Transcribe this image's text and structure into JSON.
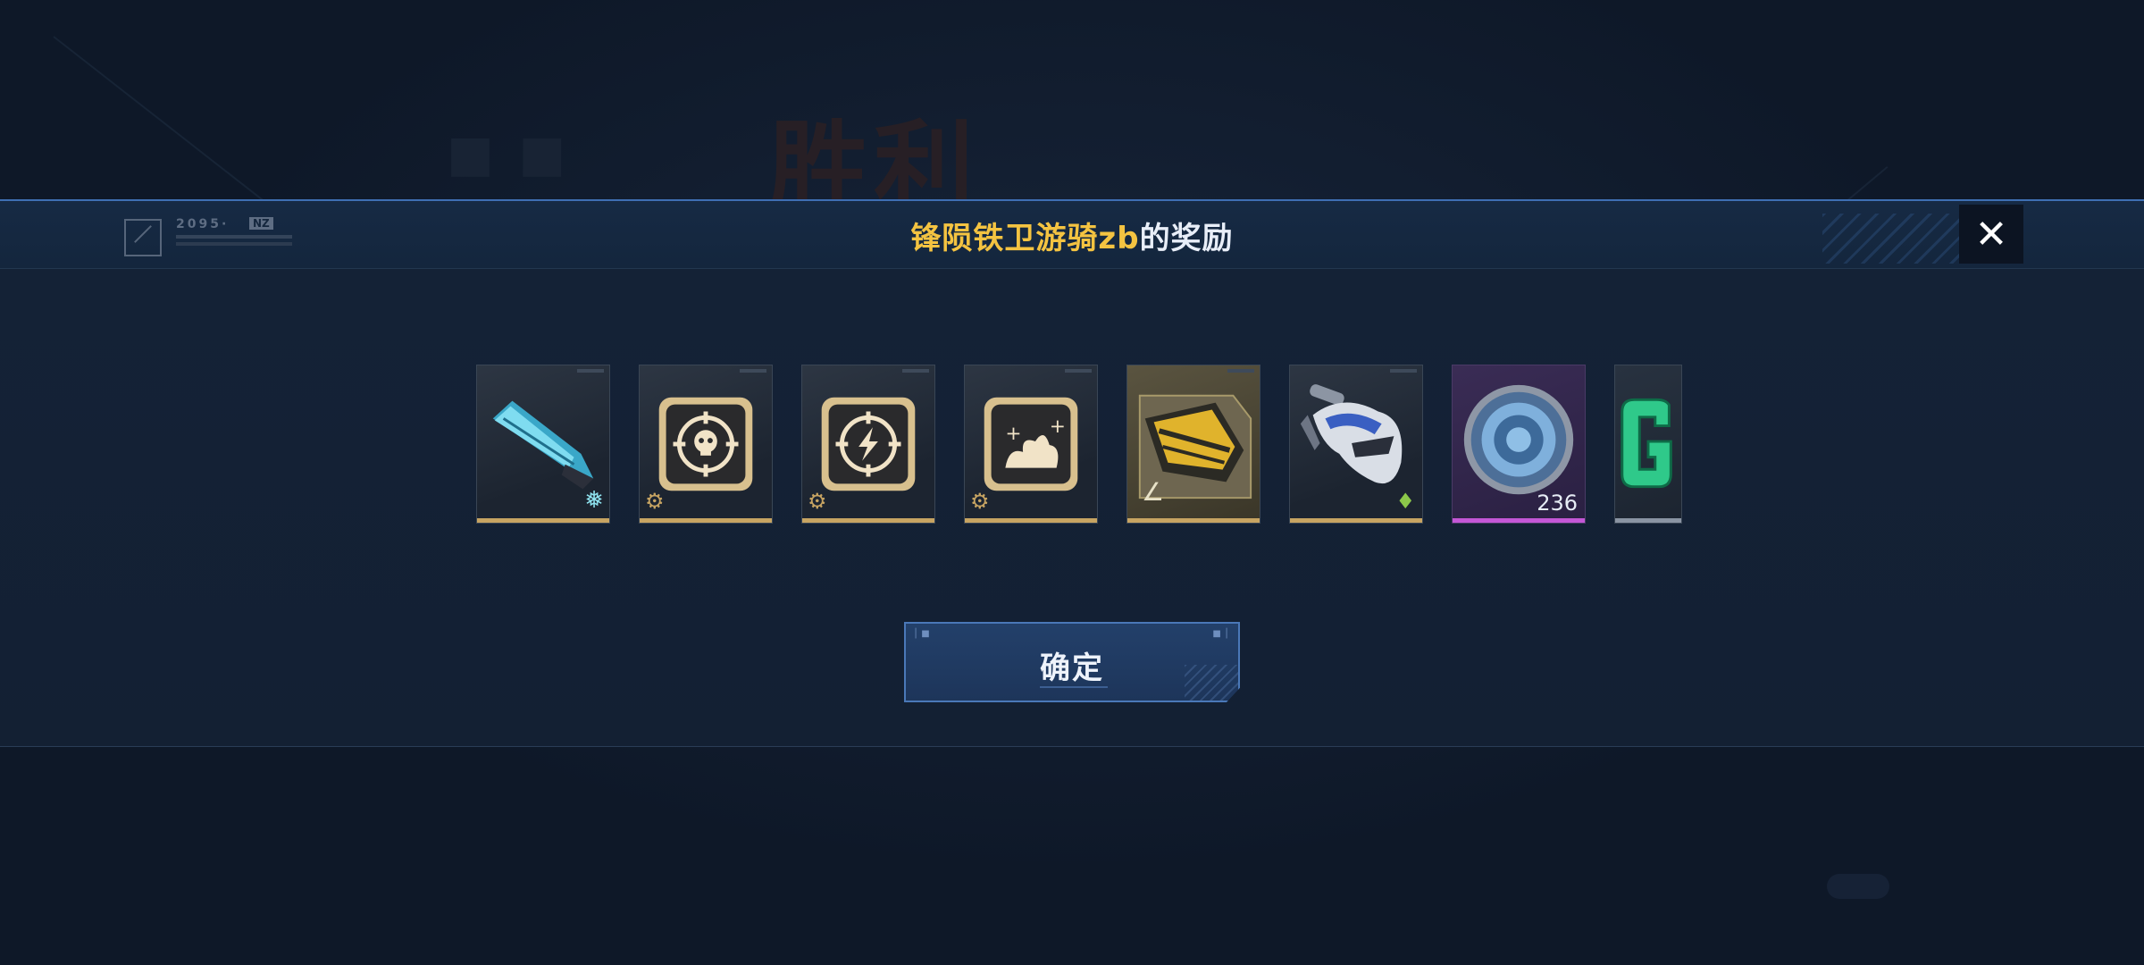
{
  "background": {
    "result_title": "胜利"
  },
  "header": {
    "logo_code": "2095·",
    "logo_tag": "NZ",
    "title_highlight": "锋陨铁卫游骑zb",
    "title_rest": "的奖励",
    "close_icon": "close-icon"
  },
  "rewards": [
    {
      "name": "knife",
      "icon": "blue-knife-icon",
      "rarity_color": "#c7a462",
      "badge": "snowflake-icon"
    },
    {
      "name": "skull-target-card",
      "icon": "skull-target-icon",
      "rarity_color": "#c7a462",
      "badge": "gear-icon"
    },
    {
      "name": "lightning-target-card",
      "icon": "lightning-target-icon",
      "rarity_color": "#c7a462",
      "badge": "gear-icon"
    },
    {
      "name": "burst-card",
      "icon": "burst-plus-icon",
      "rarity_color": "#c7a462",
      "badge": "gear-icon"
    },
    {
      "name": "gold-rifle-blueprint",
      "icon": "rifle-blueprint-icon",
      "rarity_color": "#c7a462",
      "badge": "compass-icon"
    },
    {
      "name": "shark-launcher",
      "icon": "shark-launcher-icon",
      "rarity_color": "#c7a462",
      "badge": "green-tag-icon"
    },
    {
      "name": "blue-disc",
      "icon": "disc-icon",
      "rarity_color": "#c457d6",
      "count": "236"
    },
    {
      "name": "g-token",
      "icon": "letter-g-icon",
      "rarity_color": "#8a94a3"
    }
  ],
  "confirm": {
    "label": "确定"
  }
}
